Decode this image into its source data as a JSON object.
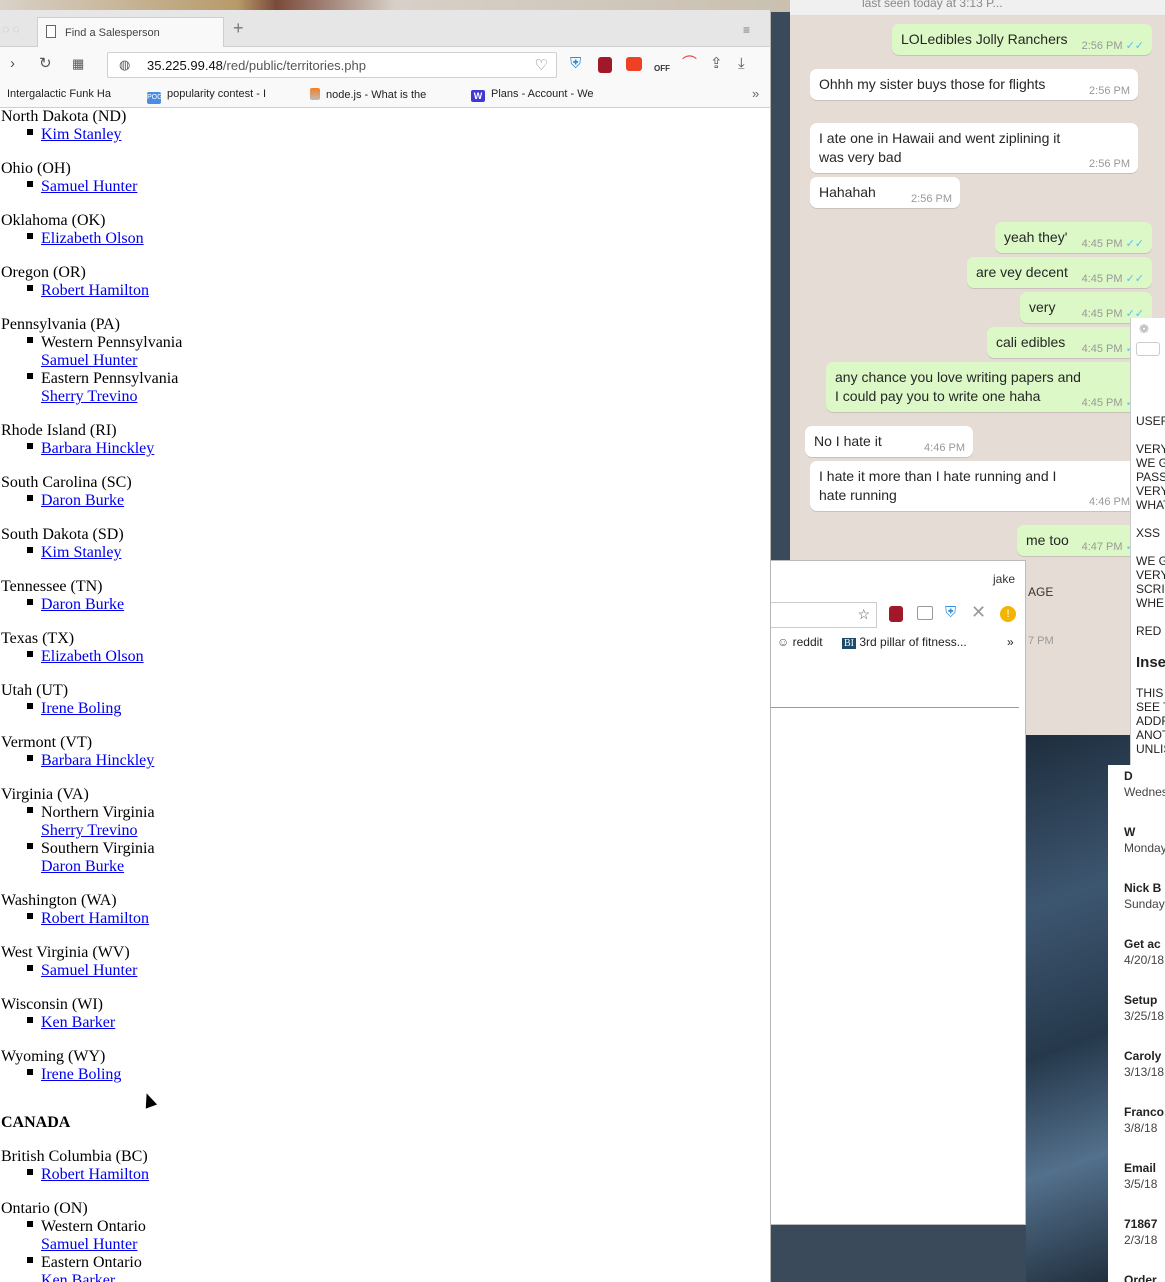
{
  "browser": {
    "tab_title": "Find a Salesperson",
    "url_host": "35.225.99.48",
    "url_path": "/red/public/territories.php",
    "bookmarks": [
      {
        "label": "Intergalactic Funk Ha",
        "icon": "image-icon"
      },
      {
        "label": "popularity contest - I",
        "icon": "pog-icon",
        "badge": "POG"
      },
      {
        "label": "node.js - What is the",
        "icon": "stackoverflow-icon"
      },
      {
        "label": "Plans - Account - We",
        "icon": "w-logo-icon",
        "badge": "W"
      }
    ],
    "bookmarks_overflow": "»"
  },
  "territories": [
    {
      "state": "North Dakota (ND)",
      "entries": [
        {
          "rep": "Kim Stanley"
        }
      ]
    },
    {
      "state": "Ohio (OH)",
      "entries": [
        {
          "rep": "Samuel Hunter"
        }
      ]
    },
    {
      "state": "Oklahoma (OK)",
      "entries": [
        {
          "rep": "Elizabeth Olson"
        }
      ]
    },
    {
      "state": "Oregon (OR)",
      "entries": [
        {
          "rep": "Robert Hamilton"
        }
      ]
    },
    {
      "state": "Pennsylvania (PA)",
      "entries": [
        {
          "region": "Western Pennsylvania",
          "rep": "Samuel Hunter"
        },
        {
          "region": "Eastern Pennsylvania",
          "rep": "Sherry Trevino"
        }
      ]
    },
    {
      "state": "Rhode Island (RI)",
      "entries": [
        {
          "rep": "Barbara Hinckley"
        }
      ]
    },
    {
      "state": "South Carolina (SC)",
      "entries": [
        {
          "rep": "Daron Burke"
        }
      ]
    },
    {
      "state": "South Dakota (SD)",
      "entries": [
        {
          "rep": "Kim Stanley"
        }
      ]
    },
    {
      "state": "Tennessee (TN)",
      "entries": [
        {
          "rep": "Daron Burke"
        }
      ]
    },
    {
      "state": "Texas (TX)",
      "entries": [
        {
          "rep": "Elizabeth Olson"
        }
      ]
    },
    {
      "state": "Utah (UT)",
      "entries": [
        {
          "rep": "Irene Boling"
        }
      ]
    },
    {
      "state": "Vermont (VT)",
      "entries": [
        {
          "rep": "Barbara Hinckley"
        }
      ]
    },
    {
      "state": "Virginia (VA)",
      "entries": [
        {
          "region": "Northern Virginia",
          "rep": "Sherry Trevino"
        },
        {
          "region": "Southern Virginia",
          "rep": "Daron Burke"
        }
      ]
    },
    {
      "state": "Washington (WA)",
      "entries": [
        {
          "rep": "Robert Hamilton"
        }
      ]
    },
    {
      "state": "West Virginia (WV)",
      "entries": [
        {
          "rep": "Samuel Hunter"
        }
      ]
    },
    {
      "state": "Wisconsin (WI)",
      "entries": [
        {
          "rep": "Ken Barker"
        }
      ]
    },
    {
      "state": "Wyoming (WY)",
      "entries": [
        {
          "rep": "Irene Boling"
        }
      ]
    }
  ],
  "canada": {
    "heading": "CANADA",
    "territories": [
      {
        "state": "British Columbia (BC)",
        "entries": [
          {
            "rep": "Robert Hamilton"
          }
        ]
      },
      {
        "state": "Ontario (ON)",
        "entries": [
          {
            "region": "Western Ontario",
            "rep": "Samuel Hunter"
          },
          {
            "region": "Eastern Ontario",
            "rep": "Ken Barker"
          }
        ]
      }
    ]
  },
  "whatsapp": {
    "header_status": "last seen today at 3:13 P...",
    "messages": [
      {
        "dir": "out",
        "text": "LOLedibles Jolly Ranchers",
        "time": "2:56 PM"
      },
      {
        "dir": "in",
        "text": "Ohhh my sister buys those for flights",
        "time": "2:56 PM"
      },
      {
        "dir": "in",
        "text": "I ate one in Hawaii and went ziplining it was very bad",
        "time": "2:56 PM"
      },
      {
        "dir": "in",
        "text": "Hahahah",
        "time": "2:56 PM"
      },
      {
        "dir": "out",
        "text": "yeah they'",
        "time": "4:45 PM"
      },
      {
        "dir": "out",
        "text": "are vey decent",
        "time": "4:45 PM"
      },
      {
        "dir": "out",
        "text": "very",
        "time": "4:45 PM"
      },
      {
        "dir": "out",
        "text": "cali edibles",
        "time": "4:45 PM"
      },
      {
        "dir": "out",
        "text": "any chance you love writing papers and I could pay you to write one haha",
        "time": "4:45 PM"
      },
      {
        "dir": "in",
        "text": "No I hate it",
        "time": "4:46 PM"
      },
      {
        "dir": "in",
        "text": "I hate it more than I hate running and I hate running",
        "time": "4:46 PM"
      },
      {
        "dir": "out",
        "text": "me too",
        "time": "4:47 PM"
      }
    ],
    "partial_label": "AGE",
    "partial_time": "7 PM"
  },
  "chrome_window": {
    "profile": "jake",
    "bookmarks": [
      "reddit",
      "3rd pillar of fitness..."
    ],
    "overflow": "»"
  },
  "notes_window": {
    "lines": [
      "USER",
      "VERY",
      "WE G",
      "PASS",
      "VERY",
      "WHAT",
      "XSS",
      "WE G",
      "VERY",
      "SCRI",
      "WHEI",
      "RED",
      "Inse",
      "THIS",
      "SEE T",
      "ADDR",
      "ANOT",
      "UNLIS"
    ]
  },
  "mail_list": [
    {
      "subject": "D",
      "date": "Wednes"
    },
    {
      "subject": "W",
      "date": "Monday"
    },
    {
      "subject": "Nick B",
      "date": "Sunday"
    },
    {
      "subject": "Get ac",
      "date": "4/20/18"
    },
    {
      "subject": "Setup",
      "date": "3/25/18"
    },
    {
      "subject": "Caroly",
      "date": "3/13/18"
    },
    {
      "subject": "Franco",
      "date": "3/8/18"
    },
    {
      "subject": "Email",
      "date": "3/5/18"
    },
    {
      "subject": "71867",
      "date": "2/3/18"
    },
    {
      "subject": "Order",
      "date": ""
    }
  ]
}
